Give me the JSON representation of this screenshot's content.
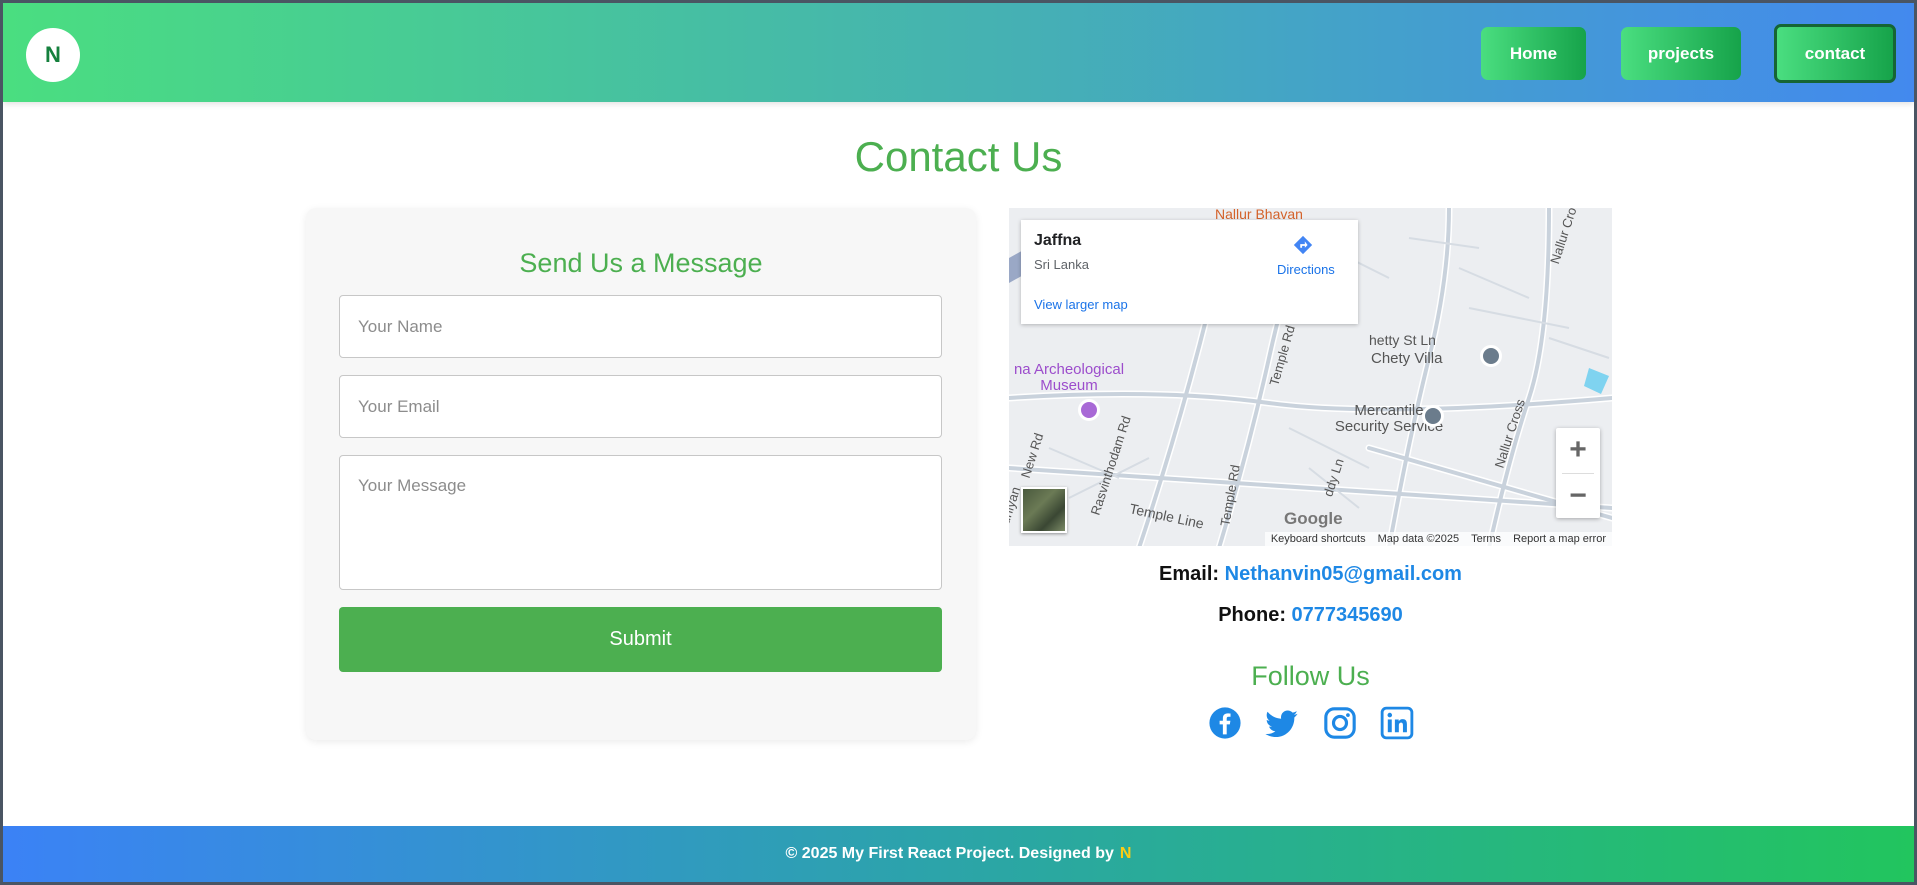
{
  "header": {
    "logo_letter": "N",
    "nav": [
      {
        "label": "Home"
      },
      {
        "label": "projects"
      },
      {
        "label": "contact"
      }
    ]
  },
  "page": {
    "title": "Contact Us"
  },
  "form": {
    "title": "Send Us a Message",
    "name_placeholder": "Your Name",
    "email_placeholder": "Your Email",
    "message_placeholder": "Your Message",
    "submit_label": "Submit"
  },
  "map": {
    "info": {
      "city": "Jaffna",
      "country": "Sri Lanka",
      "larger_map_link": "View larger map",
      "directions_label": "Directions"
    },
    "labels": {
      "nallur_bhavan": "Nallur Bhavan",
      "chety_villa": "Chety Villa",
      "museum": "na Archeological Museum",
      "mercantile": "Mercantile Security Service",
      "chetty_st": "hetty St Ln",
      "temple_rd": "Temple Rd",
      "temple_rd_2": "Temple Rd",
      "temple_line": "Temple Line",
      "rasvinthodam": "Rasvinthodam Rd",
      "nallur_cross": "Nallur Cross",
      "nallur_cross_2": "Nallur Cro",
      "new_rd": "New Rd",
      "uniyan": "uniyan",
      "reddy_ln": "ddy Ln"
    },
    "google_mark": "Google",
    "footer": {
      "shortcuts": "Keyboard shortcuts",
      "map_data": "Map data ©2025",
      "terms": "Terms",
      "report": "Report a map error"
    },
    "zoom_in": "+",
    "zoom_out": "−"
  },
  "contact": {
    "email_label": "Email:",
    "email_value": "Nethanvin05@gmail.com",
    "phone_label": "Phone:",
    "phone_value": "0777345690",
    "follow_title": "Follow Us",
    "social": [
      "facebook-icon",
      "twitter-icon",
      "instagram-icon",
      "linkedin-icon"
    ],
    "accent_color": "#1e88e5"
  },
  "footer": {
    "text": "© 2025 My First React Project. Designed by",
    "brand": "N"
  },
  "colors": {
    "primary_green": "#4caf50",
    "link_blue": "#1e88e5",
    "brand_yellow": "#facc15"
  }
}
